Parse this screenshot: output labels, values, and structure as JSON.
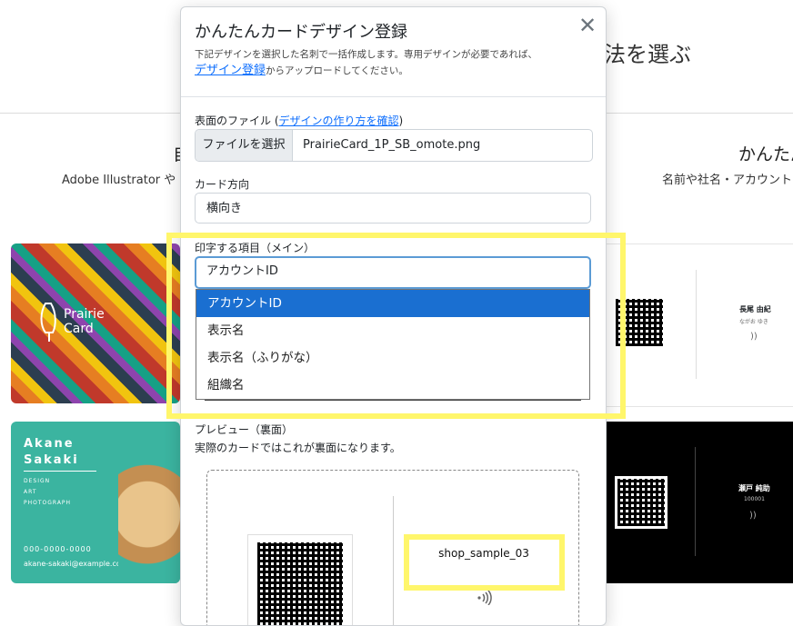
{
  "background": {
    "heading": "法を選ぶ",
    "column_left_title": "自",
    "column_right_title": "かんたん",
    "column_left_desc": "Adobe Illustrator や Ca",
    "column_right_desc": "名前や社名・アカウントIDを",
    "card_prairie_logo": "Prairie\nCard",
    "card_akane": {
      "name": "Akane\nSakaki",
      "role": "DESIGN\nART\nPHOTOGRAPH",
      "phone": "000-0000-0000",
      "email": "akane-sakaki@example.com"
    },
    "card_right_top": {
      "name": "長尾 由紀",
      "kana": "ながお ゆき"
    },
    "card_right_bottom": {
      "name": "瀬戸 純助",
      "id": "100001"
    }
  },
  "modal": {
    "title": "かんたんカードデザイン登録",
    "desc_line1": "下記デザインを選択した名刺で一括作成します。専用デザインが必要であれば、",
    "desc_link": "デザイン登録",
    "desc_line2": "からアップロードしてください。",
    "close_symbol": "✕",
    "front_file": {
      "label": "表面のファイル (",
      "help_link": "デザインの作り方を確認",
      "label_end": ")",
      "button": "ファイルを選択",
      "filename": "PrairieCard_1P_SB_omote.png"
    },
    "orientation": {
      "label": "カード方向",
      "value": "横向き"
    },
    "print_item": {
      "label": "印字する項目（メイン）",
      "value": "アカウントID",
      "options": [
        "アカウントID",
        "表示名",
        "表示名（ふりがな）",
        "組織名"
      ],
      "selected_index": 0
    },
    "preview": {
      "label": "プレビュー（裏面）",
      "desc": "実際のカードではこれが裏面になります。",
      "account_id": "shop_sample_03",
      "nfc_icon": "nfc-icon"
    }
  },
  "colors": {
    "highlight": "#fff66b",
    "selected_option": "#1a6fd1",
    "link": "#0d6efd"
  }
}
